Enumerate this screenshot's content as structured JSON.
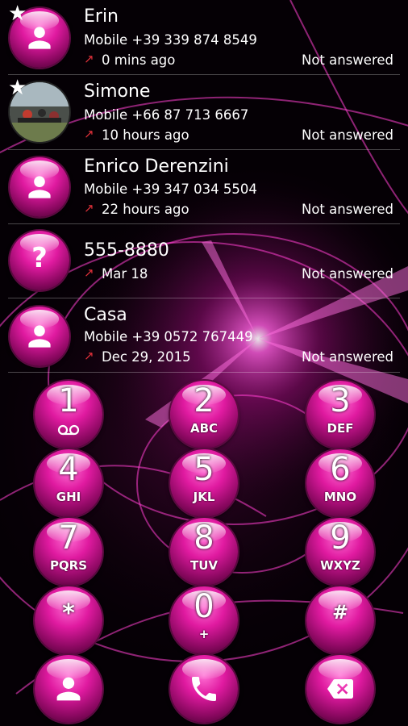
{
  "calls": [
    {
      "name": "Erin",
      "number": "Mobile +39 339 874 8549",
      "time": "0 mins ago",
      "status": "Not answered",
      "starred": true,
      "avatar": "person-icon"
    },
    {
      "name": "Simone",
      "number": "Mobile +66 87 713 6667",
      "time": "10 hours ago",
      "status": "Not answered",
      "starred": true,
      "avatar": "photo"
    },
    {
      "name": "Enrico Derenzini",
      "number": "Mobile +39 347 034 5504",
      "time": "22 hours ago",
      "status": "Not answered",
      "starred": false,
      "avatar": "person-icon"
    },
    {
      "name": "555-8880",
      "number": "",
      "time": "Mar 18",
      "status": "Not answered",
      "starred": false,
      "avatar": "question-icon"
    },
    {
      "name": "Casa",
      "number": "Mobile +39 0572 767449",
      "time": "Dec 29, 2015",
      "status": "Not answered",
      "starred": false,
      "avatar": "person-icon"
    }
  ],
  "keypad": [
    {
      "digit": "1",
      "letters": "voicemail-icon"
    },
    {
      "digit": "2",
      "letters": "ABC"
    },
    {
      "digit": "3",
      "letters": "DEF"
    },
    {
      "digit": "4",
      "letters": "GHI"
    },
    {
      "digit": "5",
      "letters": "JKL"
    },
    {
      "digit": "6",
      "letters": "MNO"
    },
    {
      "digit": "7",
      "letters": "PQRS"
    },
    {
      "digit": "8",
      "letters": "TUV"
    },
    {
      "digit": "9",
      "letters": "WXYZ"
    },
    {
      "digit": "*",
      "letters": ""
    },
    {
      "digit": "0",
      "letters": "+"
    },
    {
      "digit": "#",
      "letters": ""
    }
  ],
  "actions": {
    "contacts_icon": "person-icon",
    "call_icon": "phone-icon",
    "backspace_icon": "backspace-icon"
  },
  "colors": {
    "accent": "#e01aa0",
    "missed_arrow": "#e0303a",
    "background": "#000000"
  }
}
